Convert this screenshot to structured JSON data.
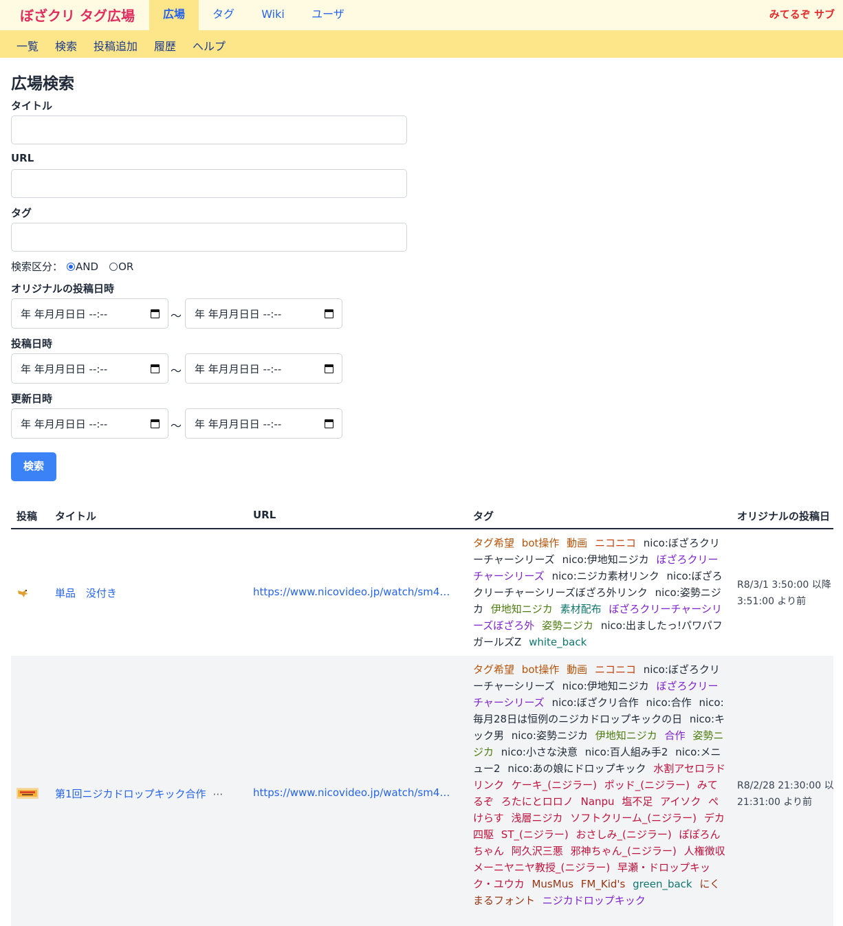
{
  "brand": "ぼざクリ タグ広場",
  "nav": {
    "tabs": [
      {
        "label": "広場"
      },
      {
        "label": "タグ"
      },
      {
        "label": "Wiki"
      },
      {
        "label": "ユーザ"
      }
    ],
    "user": "みてるぞ サブ"
  },
  "subnav": [
    "一覧",
    "検索",
    "投稿追加",
    "履歴",
    "ヘルプ"
  ],
  "form": {
    "heading": "広場検索",
    "title_label": "タイトル",
    "url_label": "URL",
    "tag_label": "タグ",
    "mode_label": "検索区分：",
    "mode_and": "AND",
    "mode_or": "OR",
    "original_date_label": "オリジナルの投稿日時",
    "post_date_label": "投稿日時",
    "updated_date_label": "更新日時",
    "date_placeholder": "年 年月月日日 --:--",
    "range_sep": "〜",
    "submit": "検索"
  },
  "table": {
    "headers": [
      "投稿",
      "タイトル",
      "URL",
      "タグ",
      "オリジナルの投稿日"
    ],
    "rows": [
      {
        "title": "単品　没付き",
        "url": "https://www.nicovideo.jp/watch/sm4…",
        "date_line1": "R8/3/1 3:50:00 以降",
        "date_line2": "3:51:00 より前",
        "tags": [
          {
            "text": "タグ希望",
            "color": "#b45309"
          },
          {
            "text": "bot操作",
            "color": "#b45309"
          },
          {
            "text": "動画",
            "color": "#b45309"
          },
          {
            "text": "ニコニコ",
            "color": "#c2410c"
          },
          {
            "text": "nico:ぼざろクリーチャーシリーズ",
            "color": "#1f2937"
          },
          {
            "text": "nico:伊地知ニジカ",
            "color": "#1f2937"
          },
          {
            "text": "ぼざろクリーチャーシリーズ",
            "color": "#7e22ce"
          },
          {
            "text": "nico:ニジカ素材リンク",
            "color": "#1f2937"
          },
          {
            "text": "nico:ぼざろクリーチャーシリーズぼざろ外リンク",
            "color": "#1f2937"
          },
          {
            "text": "nico:姿勢ニジカ",
            "color": "#1f2937"
          },
          {
            "text": "伊地知ニジカ",
            "color": "#4d7c0f"
          },
          {
            "text": "素材配布",
            "color": "#0f766e"
          },
          {
            "text": "ぼざろクリーチャーシリーズぼざろ外",
            "color": "#7e22ce"
          },
          {
            "text": "姿勢ニジカ",
            "color": "#4d7c0f"
          },
          {
            "text": "nico:出ましたっ!パワパフガールズZ",
            "color": "#1f2937"
          },
          {
            "text": "white_back",
            "color": "#0f766e"
          }
        ]
      },
      {
        "title": "第1回ニジカドロップキック合作",
        "title_more": "⋯",
        "url": "https://www.nicovideo.jp/watch/sm4…",
        "date_line1": "R8/2/28 21:30:00 以",
        "date_line2": "21:31:00 より前",
        "tags": [
          {
            "text": "タグ希望",
            "color": "#b45309"
          },
          {
            "text": "bot操作",
            "color": "#b45309"
          },
          {
            "text": "動画",
            "color": "#b45309"
          },
          {
            "text": "ニコニコ",
            "color": "#c2410c"
          },
          {
            "text": "nico:ぼざろクリーチャーシリーズ",
            "color": "#1f2937"
          },
          {
            "text": "nico:伊地知ニジカ",
            "color": "#1f2937"
          },
          {
            "text": "ぼざろクリーチャーシリーズ",
            "color": "#7e22ce"
          },
          {
            "text": "nico:ぼざクリ合作",
            "color": "#1f2937"
          },
          {
            "text": "nico:合作",
            "color": "#1f2937"
          },
          {
            "text": "nico:毎月28日は恒例のニジカドロップキックの日",
            "color": "#1f2937"
          },
          {
            "text": "nico:キック男",
            "color": "#1f2937"
          },
          {
            "text": "nico:姿勢ニジカ",
            "color": "#1f2937"
          },
          {
            "text": "伊地知ニジカ",
            "color": "#4d7c0f"
          },
          {
            "text": "合作",
            "color": "#7e22ce"
          },
          {
            "text": "姿勢ニジカ",
            "color": "#4d7c0f"
          },
          {
            "text": "nico:小さな決意",
            "color": "#1f2937"
          },
          {
            "text": "nico:百人組み手2",
            "color": "#1f2937"
          },
          {
            "text": "nico:メニュー2",
            "color": "#1f2937"
          },
          {
            "text": "nico:あの娘にドロップキック",
            "color": "#1f2937"
          },
          {
            "text": "水割アセロラドリンク",
            "color": "#be123c"
          },
          {
            "text": "ケーキ_(ニジラー)",
            "color": "#be123c"
          },
          {
            "text": "ポッド_(ニジラー)",
            "color": "#be123c"
          },
          {
            "text": "みてるぞ",
            "color": "#be123c"
          },
          {
            "text": "ろたにとロロノ",
            "color": "#be123c"
          },
          {
            "text": "Nanpu",
            "color": "#be123c"
          },
          {
            "text": "塩不足",
            "color": "#be123c"
          },
          {
            "text": "アイソク",
            "color": "#be123c"
          },
          {
            "text": "ぺけらす",
            "color": "#be123c"
          },
          {
            "text": "浅層ニジカ",
            "color": "#be123c"
          },
          {
            "text": "ソフトクリーム_(ニジラー)",
            "color": "#be123c"
          },
          {
            "text": "デカ四駆",
            "color": "#be123c"
          },
          {
            "text": "ST_(ニジラー)",
            "color": "#be123c"
          },
          {
            "text": "おさしみ_(ニジラー)",
            "color": "#be123c"
          },
          {
            "text": "ぽぽろんちゃん",
            "color": "#be123c"
          },
          {
            "text": "阿久沢三悪",
            "color": "#be123c"
          },
          {
            "text": "邪神ちゃん_(ニジラー)",
            "color": "#be123c"
          },
          {
            "text": "人権徴収メーニヤニヤ教授_(ニジラー)",
            "color": "#be123c"
          },
          {
            "text": "早瀬・ドロップキック・ユウカ",
            "color": "#be123c"
          },
          {
            "text": "MusMus",
            "color": "#9a3412"
          },
          {
            "text": "FM_Kid's",
            "color": "#9a3412"
          },
          {
            "text": "green_back",
            "color": "#0f766e"
          },
          {
            "text": "にくまるフォント",
            "color": "#9a3412"
          },
          {
            "text": "ニジカドロップキック",
            "color": "#7e22ce"
          }
        ]
      }
    ]
  }
}
